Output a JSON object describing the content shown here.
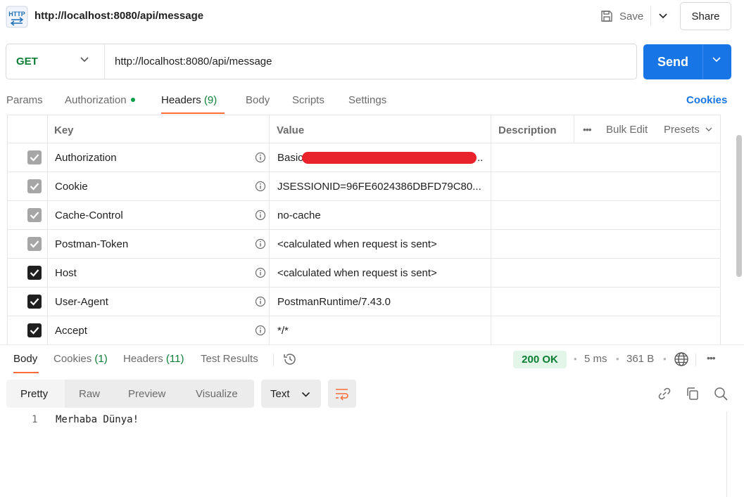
{
  "request": {
    "icon_text": "HTTP",
    "title": "http://localhost:8080/api/message",
    "save_label": "Save",
    "share_label": "Share",
    "method": "GET",
    "url": "http://localhost:8080/api/message",
    "send_label": "Send"
  },
  "request_tabs": {
    "params": "Params",
    "authorization": "Authorization",
    "headers": "Headers",
    "headers_count": "(9)",
    "body": "Body",
    "scripts": "Scripts",
    "settings": "Settings",
    "cookies": "Cookies"
  },
  "headers_table": {
    "columns": {
      "key": "Key",
      "value": "Value",
      "description": "Description"
    },
    "bulk_edit": "Bulk Edit",
    "presets": "Presets",
    "rows": [
      {
        "checked": "auto",
        "key": "Authorization",
        "value": "Basic",
        "value_tail": "..",
        "redacted": true
      },
      {
        "checked": "auto",
        "key": "Cookie",
        "value": "JSESSIONID=96FE6024386DBFD79C80...",
        "redacted": false
      },
      {
        "checked": "auto",
        "key": "Cache-Control",
        "value": "no-cache",
        "redacted": false
      },
      {
        "checked": "auto",
        "key": "Postman-Token",
        "value": "<calculated when request is sent>",
        "redacted": false
      },
      {
        "checked": "user",
        "key": "Host",
        "value": "<calculated when request is sent>",
        "redacted": false
      },
      {
        "checked": "user",
        "key": "User-Agent",
        "value": "PostmanRuntime/7.43.0",
        "redacted": false
      },
      {
        "checked": "user",
        "key": "Accept",
        "value": "*/*",
        "redacted": false
      }
    ]
  },
  "response": {
    "tabs": {
      "body": "Body",
      "cookies": "Cookies",
      "cookies_count": "(1)",
      "headers": "Headers",
      "headers_count": "(11)",
      "test_results": "Test Results"
    },
    "status": "200 OK",
    "time": "5 ms",
    "size": "361 B",
    "views": {
      "pretty": "Pretty",
      "raw": "Raw",
      "preview": "Preview",
      "visualize": "Visualize"
    },
    "format": "Text",
    "lines": [
      {
        "no": "1",
        "text": "Merhaba Dünya!"
      }
    ]
  },
  "colors": {
    "accent": "#ff6c37",
    "send": "#1775e6",
    "get_method": "#0b7e34",
    "status_ok_bg": "#e3f5e9",
    "redaction": "#e8232b"
  }
}
